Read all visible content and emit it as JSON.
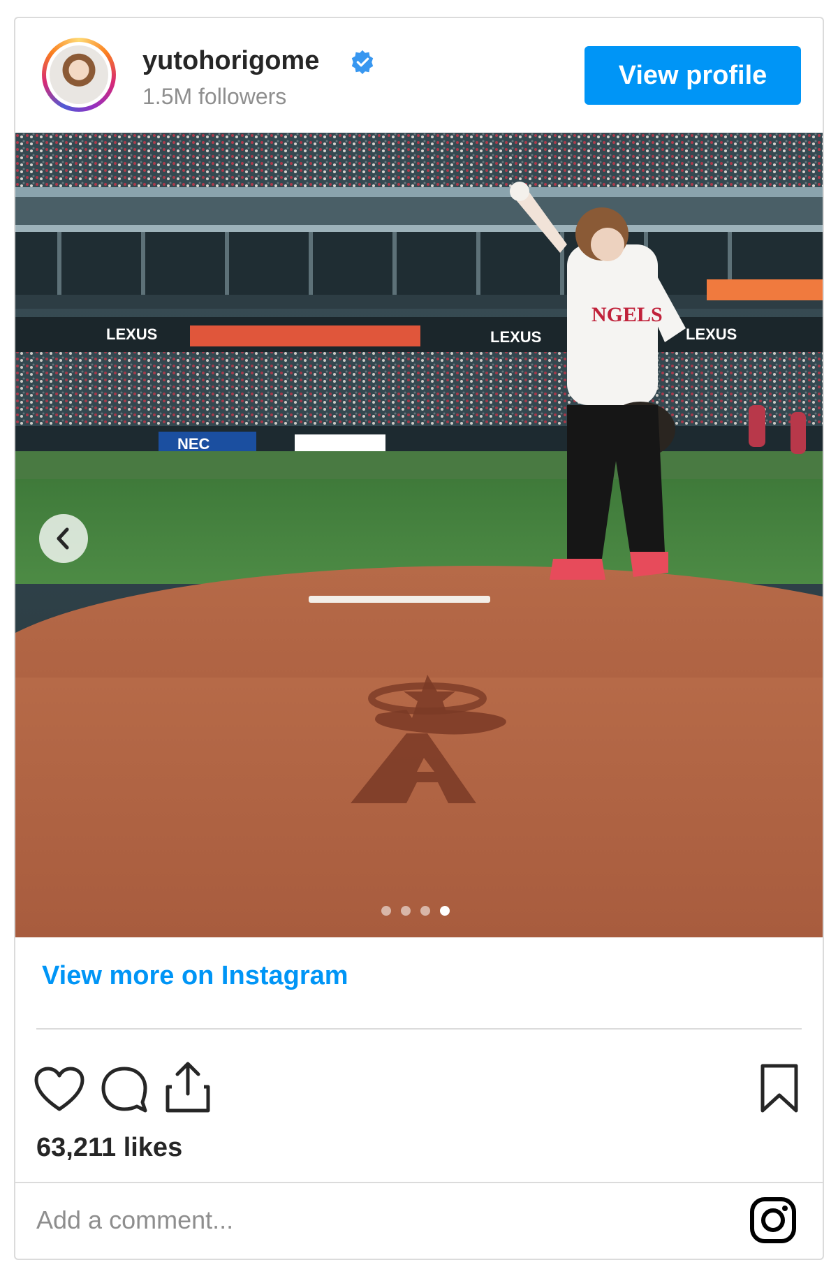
{
  "post": {
    "username": "yutohorigome",
    "followers": "1.5M followers",
    "view_profile_label": "View profile",
    "view_more_label": "View more on Instagram",
    "likes": "63,211 likes",
    "comment_placeholder": "Add a comment...",
    "carousel_total": 4,
    "carousel_active": 4
  },
  "colors": {
    "accent": "#0095f6",
    "text": "#262626",
    "muted": "#8e8e8e",
    "border": "#dbdbdb"
  },
  "icons": [
    "verified-badge-icon",
    "chevron-left-icon",
    "heart-icon",
    "comment-icon",
    "share-icon",
    "bookmark-icon",
    "instagram-icon"
  ]
}
